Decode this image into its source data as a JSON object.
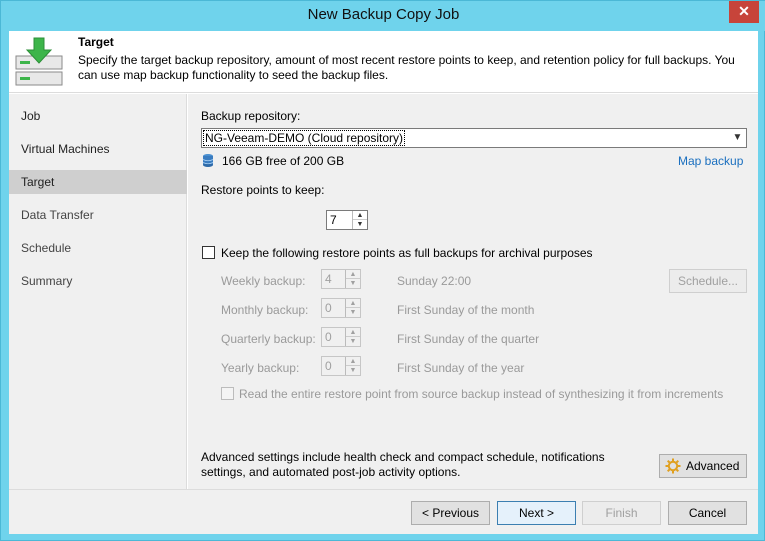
{
  "window": {
    "title": "New Backup Copy Job",
    "close_glyph": "✕"
  },
  "header": {
    "title": "Target",
    "description": "Specify the target backup repository, amount of most recent restore points to keep, and retention policy for full backups. You can use map backup functionality to seed the backup files."
  },
  "nav": {
    "items": [
      {
        "label": "Job",
        "selected": false
      },
      {
        "label": "Virtual Machines",
        "selected": false
      },
      {
        "label": "Target",
        "selected": true
      },
      {
        "label": "Data Transfer",
        "selected": false
      },
      {
        "label": "Schedule",
        "selected": false
      },
      {
        "label": "Summary",
        "selected": false
      }
    ]
  },
  "target": {
    "repository_label": "Backup repository:",
    "repository_value": "NG-Veeam-DEMO (Cloud repository)",
    "free_space": "166 GB free of 200 GB",
    "map_backup_link": "Map backup",
    "restore_points_label": "Restore points to keep:",
    "restore_points_value": "7",
    "archival_checkbox_label": "Keep the following restore points as full backups for archival purposes",
    "archival_checked": false,
    "weekly_label": "Weekly backup:",
    "weekly_value": "4",
    "weekly_schedule": "Sunday 22:00",
    "schedule_button": "Schedule...",
    "monthly_label": "Monthly backup:",
    "monthly_value": "0",
    "monthly_schedule": "First Sunday of the month",
    "quarterly_label": "Quarterly backup:",
    "quarterly_value": "0",
    "quarterly_schedule": "First Sunday of the quarter",
    "yearly_label": "Yearly backup:",
    "yearly_value": "0",
    "yearly_schedule": "First Sunday of the year",
    "read_entire_label": "Read the entire restore point from source backup instead of synthesizing it from increments",
    "advanced_text": "Advanced settings include health check and compact schedule, notifications settings, and automated post-job activity options.",
    "advanced_button": "Advanced"
  },
  "footer": {
    "previous": "< Previous",
    "next": "Next >",
    "finish": "Finish",
    "cancel": "Cancel"
  },
  "icons": {
    "header": "download-target-icon",
    "repository": "database-icon",
    "advanced": "gear-icon"
  },
  "colors": {
    "title_bar": "#6fd3ec",
    "close_button": "#c7443a",
    "link": "#1a6fbf",
    "selected_nav": "#cfcfcf",
    "header_arrow": "#3db54a"
  }
}
